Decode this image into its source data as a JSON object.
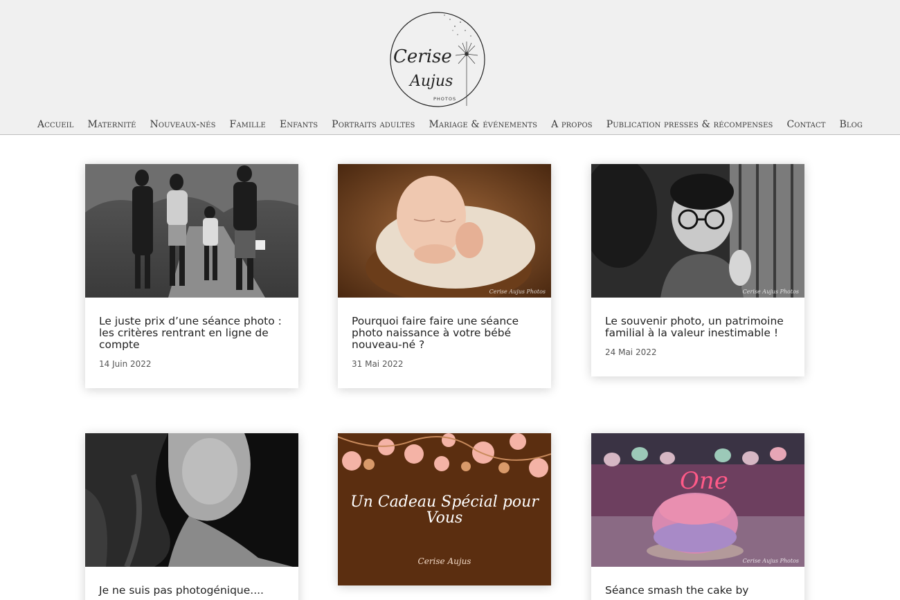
{
  "brand": {
    "logo_line1": "Cerise",
    "logo_line2": "Aujus",
    "logo_sub": "PHOTOS"
  },
  "nav": {
    "items": [
      "Accueil",
      "Maternité",
      "Nouveaux-nés",
      "Famille",
      "Enfants",
      "Portraits adultes",
      "Mariage & événements",
      "A propos",
      "Publication presses & récompenses",
      "Contact",
      "Blog"
    ]
  },
  "posts": [
    {
      "title": "Le juste prix d’une séance photo : les critères rentrant en ligne de compte",
      "date": "14 Juin 2022"
    },
    {
      "title": "Pourquoi faire faire une séance photo naissance à votre bébé nouveau-né ?",
      "date": "31 Mai 2022"
    },
    {
      "title": "Le souvenir photo, un patrimoine familial à la valeur inestimable !",
      "date": "24 Mai 2022"
    },
    {
      "title": "Je ne suis pas photogénique....",
      "date": ""
    },
    {
      "title": "",
      "date": ""
    },
    {
      "title": "Séance smash the cake by",
      "date": ""
    }
  ],
  "images": {
    "cadeau_text": "Un Cadeau Spécial pour Vous",
    "cadeau_logo": "Cerise Aujus",
    "cake_word": "One",
    "watermark": "Cerise Aujus Photos"
  }
}
